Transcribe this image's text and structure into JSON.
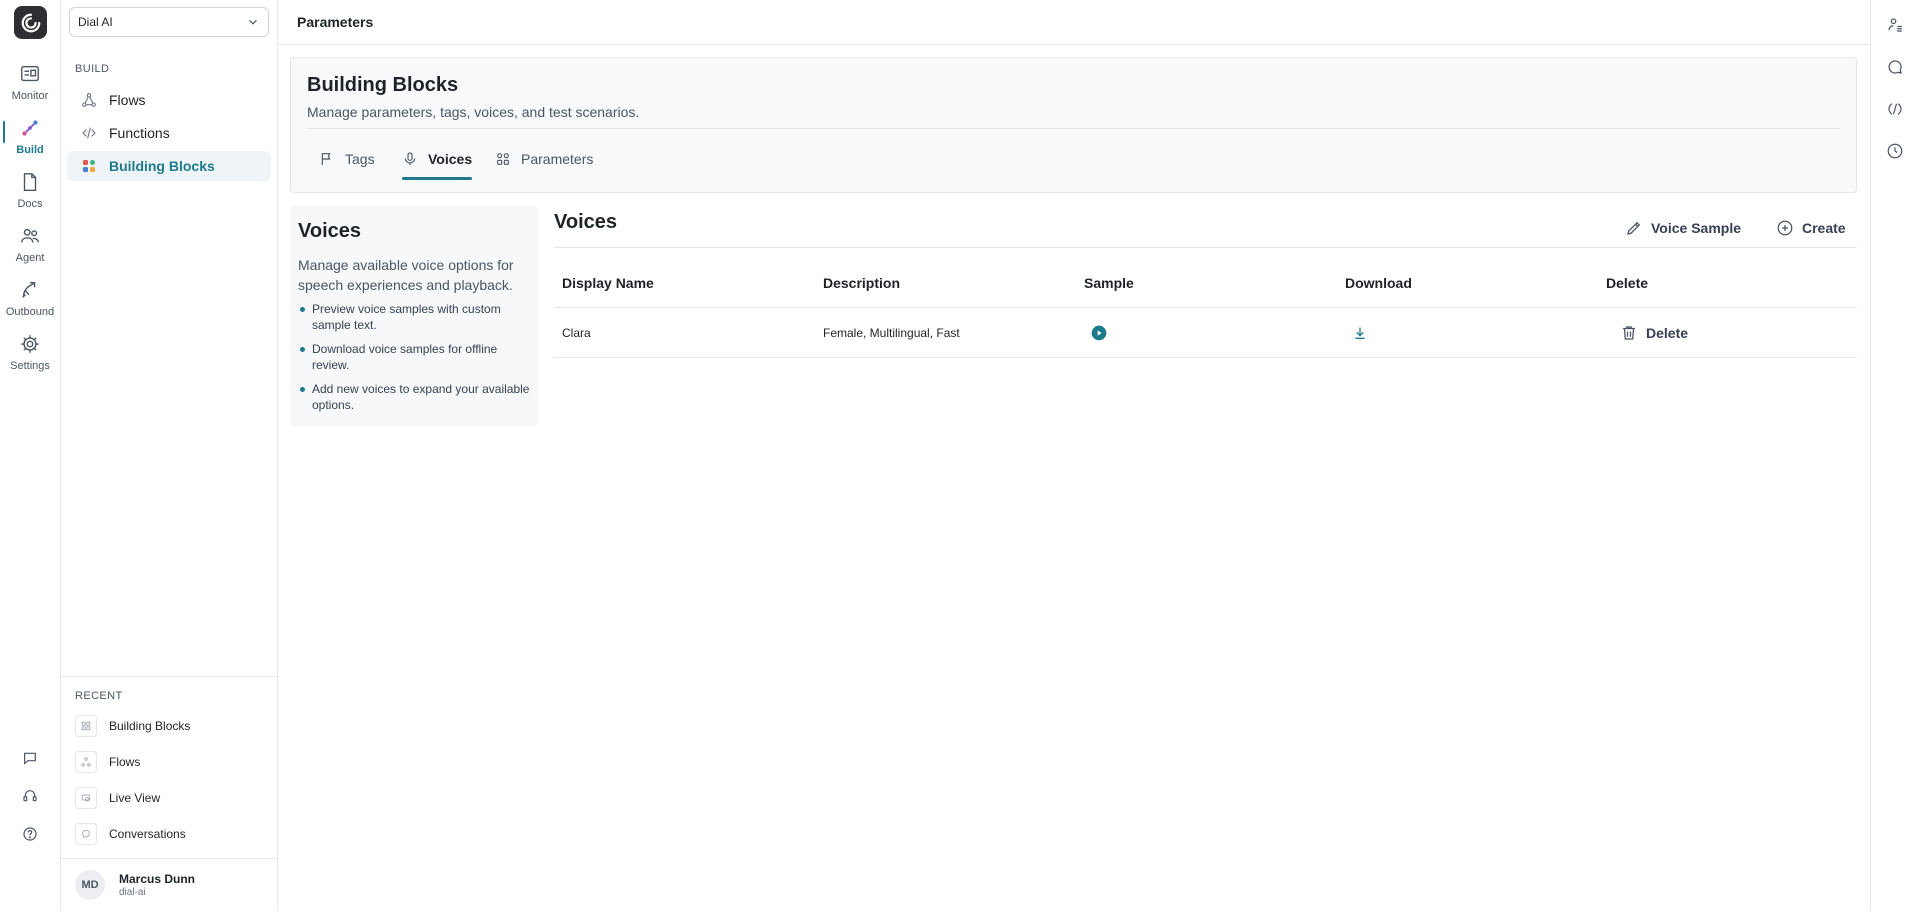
{
  "workspace": {
    "selected": "Dial AI"
  },
  "rail": {
    "items": [
      {
        "label": "Monitor",
        "icon": "monitor-icon"
      },
      {
        "label": "Build",
        "icon": "build-icon"
      },
      {
        "label": "Docs",
        "icon": "docs-icon"
      },
      {
        "label": "Agent",
        "icon": "agent-icon"
      },
      {
        "label": "Outbound",
        "icon": "outbound-icon"
      },
      {
        "label": "Settings",
        "icon": "settings-icon"
      }
    ],
    "active": "Build"
  },
  "sidebar": {
    "section": "BUILD",
    "items": [
      {
        "label": "Flows",
        "icon": "flows-icon"
      },
      {
        "label": "Functions",
        "icon": "code-icon"
      },
      {
        "label": "Building Blocks",
        "icon": "blocks-icon"
      }
    ],
    "active": "Building Blocks",
    "recent_label": "RECENT",
    "recent": [
      {
        "label": "Building Blocks"
      },
      {
        "label": "Flows"
      },
      {
        "label": "Live View"
      },
      {
        "label": "Conversations"
      }
    ]
  },
  "user": {
    "initials": "MD",
    "name": "Marcus Dunn",
    "org": "dial-ai"
  },
  "topbar": {
    "title": "Parameters"
  },
  "header": {
    "title": "Building Blocks",
    "subtitle": "Manage parameters, tags, voices, and test scenarios.",
    "tabs": [
      {
        "label": "Tags"
      },
      {
        "label": "Voices"
      },
      {
        "label": "Parameters"
      }
    ],
    "active_tab": "Voices"
  },
  "info": {
    "title": "Voices",
    "description": "Manage available voice options for speech experiences and playback.",
    "bullets": [
      "Preview voice samples with custom sample text.",
      "Download voice samples for offline review.",
      "Add new voices to expand your available options."
    ]
  },
  "voices": {
    "title": "Voices",
    "voice_sample_label": "Voice Sample",
    "create_label": "Create",
    "columns": [
      "Display Name",
      "Description",
      "Sample",
      "Download",
      "Delete"
    ],
    "rows": [
      {
        "display_name": "Clara",
        "description": "Female, Multilingual, Fast",
        "delete_label": "Delete"
      }
    ]
  },
  "colors": {
    "accent": "#1f7a8c",
    "active_bg": "#eef4f8"
  }
}
